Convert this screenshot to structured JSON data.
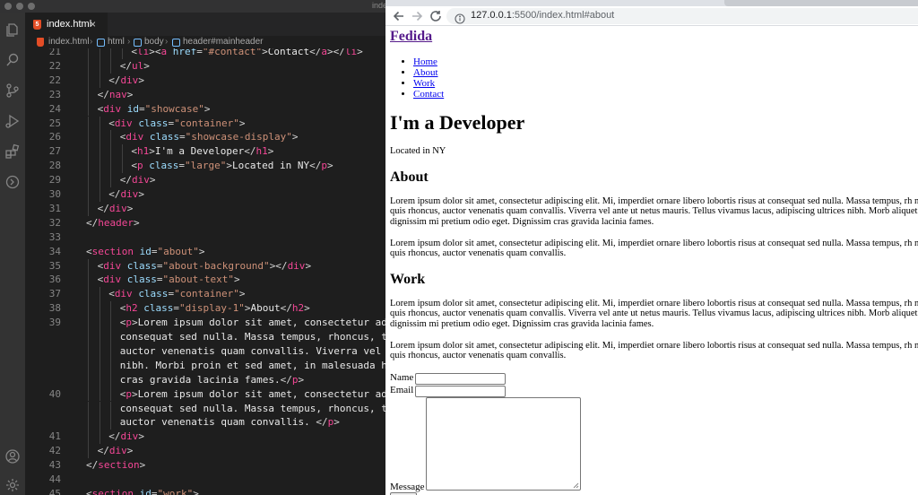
{
  "window": {
    "title": "index.html"
  },
  "editor": {
    "tab": {
      "label": "index.html",
      "close": "×"
    },
    "breadcrumb": [
      "index.html",
      "html",
      "body",
      "header#mainheader"
    ],
    "lines": [
      {
        "n": "21",
        "indent": 4,
        "parts": [
          [
            "br",
            "<"
          ],
          [
            "tag",
            "li"
          ],
          [
            "br",
            "><"
          ],
          [
            "tag",
            "a"
          ],
          [
            "br",
            " "
          ],
          [
            "att",
            "href"
          ],
          [
            "br",
            "="
          ],
          [
            "str",
            "\"#contact\""
          ],
          [
            "br",
            ">"
          ],
          [
            "txt",
            "Contact"
          ],
          [
            "br",
            "</"
          ],
          [
            "tag",
            "a"
          ],
          [
            "br",
            "></"
          ],
          [
            "tag",
            "li"
          ],
          [
            "br",
            ">"
          ]
        ]
      },
      {
        "n": "22",
        "indent": 3,
        "parts": [
          [
            "br",
            "</"
          ],
          [
            "tag",
            "ul"
          ],
          [
            "br",
            ">"
          ]
        ]
      },
      {
        "n": "22",
        "indent": 2,
        "parts": [
          [
            "br",
            "</"
          ],
          [
            "tag",
            "div"
          ],
          [
            "br",
            ">"
          ]
        ]
      },
      {
        "n": "23",
        "indent": 1,
        "parts": [
          [
            "br",
            "</"
          ],
          [
            "tag",
            "nav"
          ],
          [
            "br",
            ">"
          ]
        ]
      },
      {
        "n": "24",
        "indent": 1,
        "parts": [
          [
            "br",
            "<"
          ],
          [
            "tag",
            "div"
          ],
          [
            "br",
            " "
          ],
          [
            "att",
            "id"
          ],
          [
            "br",
            "="
          ],
          [
            "str",
            "\"showcase\""
          ],
          [
            "br",
            ">"
          ]
        ]
      },
      {
        "n": "25",
        "indent": 2,
        "parts": [
          [
            "br",
            "<"
          ],
          [
            "tag",
            "div"
          ],
          [
            "br",
            " "
          ],
          [
            "att",
            "class"
          ],
          [
            "br",
            "="
          ],
          [
            "str",
            "\"container\""
          ],
          [
            "br",
            ">"
          ]
        ]
      },
      {
        "n": "26",
        "indent": 3,
        "parts": [
          [
            "br",
            "<"
          ],
          [
            "tag",
            "div"
          ],
          [
            "br",
            " "
          ],
          [
            "att",
            "class"
          ],
          [
            "br",
            "="
          ],
          [
            "str",
            "\"showcase-display\""
          ],
          [
            "br",
            ">"
          ]
        ]
      },
      {
        "n": "27",
        "indent": 4,
        "parts": [
          [
            "br",
            "<"
          ],
          [
            "tag",
            "h1"
          ],
          [
            "br",
            ">"
          ],
          [
            "txt",
            "I'm a Developer"
          ],
          [
            "br",
            "</"
          ],
          [
            "tag",
            "h1"
          ],
          [
            "br",
            ">"
          ]
        ]
      },
      {
        "n": "28",
        "indent": 4,
        "parts": [
          [
            "br",
            "<"
          ],
          [
            "tag",
            "p"
          ],
          [
            "br",
            " "
          ],
          [
            "att",
            "class"
          ],
          [
            "br",
            "="
          ],
          [
            "str",
            "\"large\""
          ],
          [
            "br",
            ">"
          ],
          [
            "txt",
            "Located in NY"
          ],
          [
            "br",
            "</"
          ],
          [
            "tag",
            "p"
          ],
          [
            "br",
            ">"
          ]
        ]
      },
      {
        "n": "29",
        "indent": 3,
        "parts": [
          [
            "br",
            "</"
          ],
          [
            "tag",
            "div"
          ],
          [
            "br",
            ">"
          ]
        ]
      },
      {
        "n": "30",
        "indent": 2,
        "parts": [
          [
            "br",
            "</"
          ],
          [
            "tag",
            "div"
          ],
          [
            "br",
            ">"
          ]
        ]
      },
      {
        "n": "31",
        "indent": 1,
        "parts": [
          [
            "br",
            "</"
          ],
          [
            "tag",
            "div"
          ],
          [
            "br",
            ">"
          ]
        ]
      },
      {
        "n": "32",
        "indent": 0,
        "parts": [
          [
            "br",
            "</"
          ],
          [
            "tag",
            "header"
          ],
          [
            "br",
            ">"
          ]
        ]
      },
      {
        "n": "33",
        "indent": 0,
        "parts": []
      },
      {
        "n": "34",
        "indent": 0,
        "parts": [
          [
            "br",
            "<"
          ],
          [
            "tag",
            "section"
          ],
          [
            "br",
            " "
          ],
          [
            "att",
            "id"
          ],
          [
            "br",
            "="
          ],
          [
            "str",
            "\"about\""
          ],
          [
            "br",
            ">"
          ]
        ]
      },
      {
        "n": "35",
        "indent": 1,
        "parts": [
          [
            "br",
            "<"
          ],
          [
            "tag",
            "div"
          ],
          [
            "br",
            " "
          ],
          [
            "att",
            "class"
          ],
          [
            "br",
            "="
          ],
          [
            "str",
            "\"about-background\""
          ],
          [
            "br",
            "></"
          ],
          [
            "tag",
            "div"
          ],
          [
            "br",
            ">"
          ]
        ]
      },
      {
        "n": "36",
        "indent": 1,
        "parts": [
          [
            "br",
            "<"
          ],
          [
            "tag",
            "div"
          ],
          [
            "br",
            " "
          ],
          [
            "att",
            "class"
          ],
          [
            "br",
            "="
          ],
          [
            "str",
            "\"about-text\""
          ],
          [
            "br",
            ">"
          ]
        ]
      },
      {
        "n": "37",
        "indent": 2,
        "parts": [
          [
            "br",
            "<"
          ],
          [
            "tag",
            "div"
          ],
          [
            "br",
            " "
          ],
          [
            "att",
            "class"
          ],
          [
            "br",
            "="
          ],
          [
            "str",
            "\"container\""
          ],
          [
            "br",
            ">"
          ]
        ]
      },
      {
        "n": "38",
        "indent": 3,
        "parts": [
          [
            "br",
            "<"
          ],
          [
            "tag",
            "h2"
          ],
          [
            "br",
            " "
          ],
          [
            "att",
            "class"
          ],
          [
            "br",
            "="
          ],
          [
            "str",
            "\"display-1\""
          ],
          [
            "br",
            ">"
          ],
          [
            "txt",
            "About"
          ],
          [
            "br",
            "</"
          ],
          [
            "tag",
            "h2"
          ],
          [
            "br",
            ">"
          ]
        ]
      },
      {
        "n": "39",
        "indent": 3,
        "parts": [
          [
            "br",
            "<"
          ],
          [
            "tag",
            "p"
          ],
          [
            "br",
            ">"
          ],
          [
            "txt",
            "Lorem ipsum dolor sit amet, consectetur adip"
          ]
        ]
      },
      {
        "n": "",
        "indent": 3,
        "parts": [
          [
            "txt",
            "consequat sed nulla. Massa tempus, rhoncus, tri"
          ]
        ]
      },
      {
        "n": "",
        "indent": 3,
        "parts": [
          [
            "txt",
            "auctor venenatis quam convallis. Viverra vel an"
          ]
        ]
      },
      {
        "n": "",
        "indent": 3,
        "parts": [
          [
            "txt",
            "nibh. Morbi proin et sed amet, in malesuada hab"
          ]
        ]
      },
      {
        "n": "",
        "indent": 3,
        "parts": [
          [
            "txt",
            "cras gravida lacinia fames."
          ],
          [
            "br",
            "</"
          ],
          [
            "tag",
            "p"
          ],
          [
            "br",
            ">"
          ]
        ]
      },
      {
        "n": "40",
        "indent": 3,
        "parts": [
          [
            "br",
            "<"
          ],
          [
            "tag",
            "p"
          ],
          [
            "br",
            ">"
          ],
          [
            "txt",
            "Lorem ipsum dolor sit amet, consectetur adip"
          ]
        ]
      },
      {
        "n": "",
        "indent": 3,
        "parts": [
          [
            "txt",
            "consequat sed nulla. Massa tempus, rhoncus, tri"
          ]
        ]
      },
      {
        "n": "",
        "indent": 3,
        "parts": [
          [
            "txt",
            "auctor venenatis quam convallis. "
          ],
          [
            "br",
            "</"
          ],
          [
            "tag",
            "p"
          ],
          [
            "br",
            ">"
          ]
        ]
      },
      {
        "n": "41",
        "indent": 2,
        "parts": [
          [
            "br",
            "</"
          ],
          [
            "tag",
            "div"
          ],
          [
            "br",
            ">"
          ]
        ]
      },
      {
        "n": "42",
        "indent": 1,
        "parts": [
          [
            "br",
            "</"
          ],
          [
            "tag",
            "div"
          ],
          [
            "br",
            ">"
          ]
        ]
      },
      {
        "n": "43",
        "indent": 0,
        "parts": [
          [
            "br",
            "</"
          ],
          [
            "tag",
            "section"
          ],
          [
            "br",
            ">"
          ]
        ]
      },
      {
        "n": "44",
        "indent": 0,
        "parts": []
      },
      {
        "n": "45",
        "indent": 0,
        "parts": [
          [
            "br",
            "<"
          ],
          [
            "tag",
            "section"
          ],
          [
            "br",
            " "
          ],
          [
            "att",
            "id"
          ],
          [
            "br",
            "="
          ],
          [
            "str",
            "\"work\""
          ],
          [
            "br",
            ">"
          ]
        ]
      }
    ]
  },
  "browser": {
    "url_host": "127.0.0.1",
    "url_rest": ":5500/index.html#about",
    "page": {
      "logo": "Fedida",
      "nav": [
        "Home",
        "About",
        "Work",
        "Contact"
      ],
      "heading": "I'm a Developer",
      "location": "Located in NY",
      "about_title": "About",
      "about_p1": "Lorem ipsum dolor sit amet, consectetur adipiscing elit. Mi, imperdiet ornare libero lobortis risus at consequat sed nulla. Massa tempus, rh neque quis rhoncus, auctor venenatis quam convallis. Viverra vel ante ut netus mauris. Tellus vivamus lacus, adipiscing ultrices nibh. Morb aliquet dignissim mi pretium odio eget. Dignissim cras gravida lacinia fames.",
      "about_p2": "Lorem ipsum dolor sit amet, consectetur adipiscing elit. Mi, imperdiet ornare libero lobortis risus at consequat sed nulla. Massa tempus, rh neque quis rhoncus, auctor venenatis quam convallis.",
      "work_title": "Work",
      "work_p1": "Lorem ipsum dolor sit amet, consectetur adipiscing elit. Mi, imperdiet ornare libero lobortis risus at consequat sed nulla. Massa tempus, rh neque quis rhoncus, auctor venenatis quam convallis. Viverra vel ante ut netus mauris. Tellus vivamus lacus, adipiscing ultrices nibh. Morb aliquet dignissim mi pretium odio eget. Dignissim cras gravida lacinia fames.",
      "work_p2": "Lorem ipsum dolor sit amet, consectetur adipiscing elit. Mi, imperdiet ornare libero lobortis risus at consequat sed nulla. Massa tempus, rh neque quis rhoncus, auctor venenatis quam convallis.",
      "form": {
        "name_label": "Name",
        "email_label": "Email",
        "message_label": "Message"
      }
    }
  },
  "colors": {
    "tag": "#f44796",
    "attr": "#9cdcfe",
    "string": "#ce9178",
    "text": "#e8e8e8",
    "link": "#0000ee",
    "visited": "#551a8b"
  }
}
